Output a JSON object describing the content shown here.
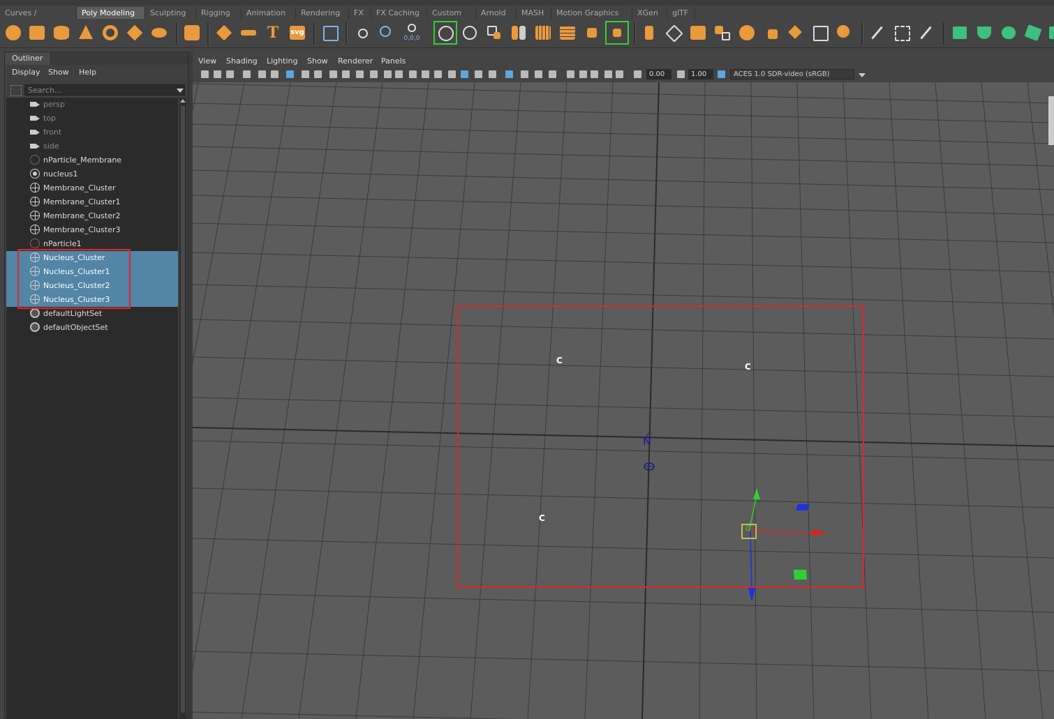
{
  "shelf_tabs": [
    "Curves / Surfaces",
    "Poly Modeling",
    "Sculpting",
    "Rigging",
    "Animation",
    "Rendering",
    "FX",
    "FX Caching",
    "Custom",
    "Arnold",
    "MASH",
    "Motion Graphics",
    "XGen",
    "glTF"
  ],
  "active_shelf_tab": "Poly Modeling",
  "shelf_icons": {
    "svg_label": "svg",
    "text_label": "T",
    "coords_label": "0,0,0"
  },
  "outliner": {
    "title": "Outliner",
    "menu": [
      "Display",
      "Show",
      "Help"
    ],
    "search_placeholder": "Search...",
    "items": [
      {
        "label": "persp",
        "icon": "camera-icon",
        "dim": true,
        "selected": false
      },
      {
        "label": "top",
        "icon": "camera-icon",
        "dim": true,
        "selected": false
      },
      {
        "label": "front",
        "icon": "camera-icon",
        "dim": true,
        "selected": false
      },
      {
        "label": "side",
        "icon": "camera-icon",
        "dim": true,
        "selected": false
      },
      {
        "label": "nParticle_Membrane",
        "icon": "nparticle-icon",
        "dim": false,
        "selected": false
      },
      {
        "label": "nucleus1",
        "icon": "nucleus-icon",
        "dim": false,
        "selected": false
      },
      {
        "label": "Membrane_Cluster",
        "icon": "cluster-icon",
        "dim": false,
        "selected": false
      },
      {
        "label": "Membrane_Cluster1",
        "icon": "cluster-icon",
        "dim": false,
        "selected": false
      },
      {
        "label": "Membrane_Cluster2",
        "icon": "cluster-icon",
        "dim": false,
        "selected": false
      },
      {
        "label": "Membrane_Cluster3",
        "icon": "cluster-icon",
        "dim": false,
        "selected": false
      },
      {
        "label": "nParticle1",
        "icon": "nparticle-icon",
        "dim": false,
        "selected": false
      },
      {
        "label": "Nucleus_Cluster",
        "icon": "cluster-icon",
        "dim": false,
        "selected": true
      },
      {
        "label": "Nucleus_Cluster1",
        "icon": "cluster-icon",
        "dim": false,
        "selected": true
      },
      {
        "label": "Nucleus_Cluster2",
        "icon": "cluster-icon",
        "dim": false,
        "selected": true
      },
      {
        "label": "Nucleus_Cluster3",
        "icon": "cluster-icon",
        "dim": false,
        "selected": true
      },
      {
        "label": "defaultLightSet",
        "icon": "set-icon",
        "dim": false,
        "selected": false
      },
      {
        "label": "defaultObjectSet",
        "icon": "set-icon",
        "dim": false,
        "selected": false
      }
    ]
  },
  "viewport": {
    "menu": [
      "View",
      "Shading",
      "Lighting",
      "Show",
      "Renderer",
      "Panels"
    ],
    "exposure": "0.00",
    "gamma": "1.00",
    "color_space": "ACES 1.0 SDR-video (sRGB)",
    "cluster_handle_label": "C",
    "nucleus_label": "N"
  },
  "colors": {
    "selection": "#5285a6",
    "highlight_outline": "#e0262c",
    "shelf_icon": "#e89a3c",
    "axis_x": "#e02020",
    "axis_y": "#30d030",
    "axis_z": "#2030e0"
  }
}
